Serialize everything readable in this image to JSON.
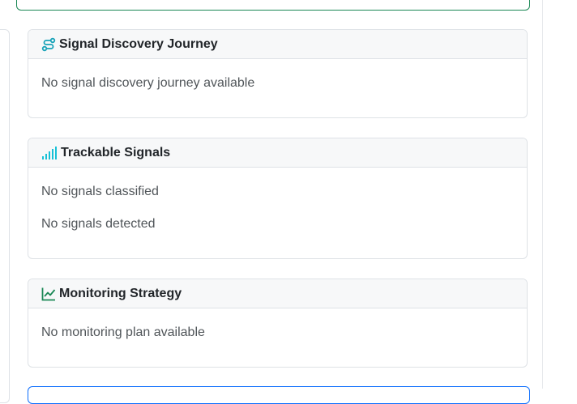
{
  "sections": [
    {
      "id": "journey",
      "title": "Signal Discovery Journey",
      "icon": "route-icon",
      "icon_color": "#17a2b8",
      "lines": [
        "No signal discovery journey available"
      ]
    },
    {
      "id": "signals",
      "title": "Trackable Signals",
      "icon": "signal-bars-icon",
      "icon_color": "#17c1d6",
      "lines": [
        "No signals classified",
        "No signals detected"
      ]
    },
    {
      "id": "monitoring",
      "title": "Monitoring Strategy",
      "icon": "line-chart-icon",
      "icon_color": "#198754",
      "lines": [
        "No monitoring plan available"
      ]
    }
  ]
}
